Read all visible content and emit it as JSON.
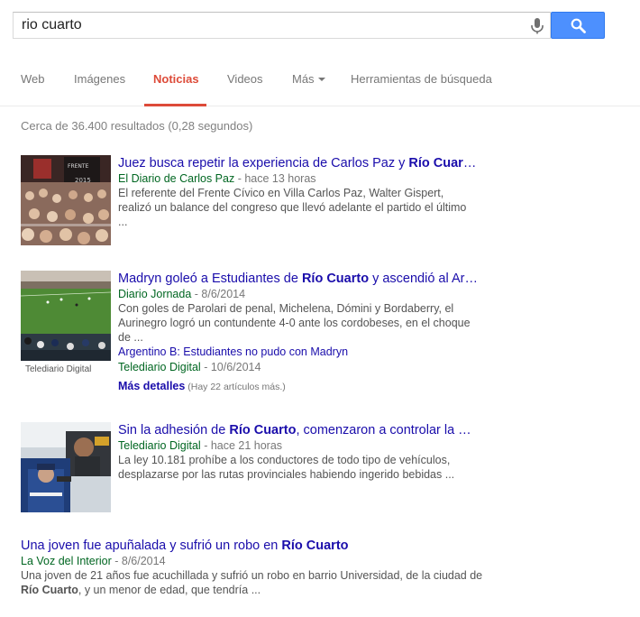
{
  "search": {
    "query": "rio cuarto"
  },
  "tabs": [
    {
      "label": "Web"
    },
    {
      "label": "Imágenes"
    },
    {
      "label": "Noticias"
    },
    {
      "label": "Videos"
    },
    {
      "label": "Más"
    },
    {
      "label": "Herramientas de búsqueda"
    }
  ],
  "stats": "Cerca de 36.400 resultados (0,28 segundos)",
  "results": [
    {
      "title_pre": "Juez busca repetir la experiencia de Carlos Paz y ",
      "title_bold": "Río Cuar",
      "title_post": "…",
      "source": "El Diario de Carlos Paz",
      "date": " - hace 13 horas",
      "snippet": "El referente del Frente Cívico en Villa Carlos Paz, Walter Gispert, realizó un balance del congreso que llevó adelante el partido el último ..."
    },
    {
      "title_pre": "Madryn goleó a Estudiantes de ",
      "title_bold": "Río Cuarto",
      "title_post": " y ascendió al Ar…",
      "source": "Diario Jornada",
      "date": " - 8/6/2014",
      "snippet": "Con goles de Parolari de penal, Michelena, Dómini y Bordaberry, el Aurinegro logró un contundente 4-0 ante los cordobeses, en el choque de ...",
      "sub_title": "Argentino B: Estudiantes no pudo con Madryn",
      "sub_source": "Telediario Digital",
      "sub_date": " - 10/6/2014",
      "more_label": "Más detalles",
      "more_note": " (Hay 22 artículos más.)",
      "caption": "Telediario Digital"
    },
    {
      "title_pre": "Sin la adhesión de ",
      "title_bold": "Río Cuarto",
      "title_post": ", comenzaron a controlar la …",
      "source": "Telediario Digital",
      "date": " - hace 21 horas",
      "snippet": "La ley 10.181 prohíbe a los conductores de todo tipo de vehículos, desplazarse por las rutas provinciales habiendo ingerido bebidas ..."
    },
    {
      "title_pre": "Una joven fue apuñalada y sufrió un robo en ",
      "title_bold": "Río Cuarto",
      "title_post": "",
      "source": "La Voz del Interior",
      "date": " - 8/6/2014",
      "snippet_pre": "Una joven de 21 años fue acuchillada y sufrió un robo en barrio Universidad, de la ciudad de ",
      "snippet_bold": "Río Cuarto",
      "snippet_post": ", y un menor de edad, que tendría ..."
    }
  ],
  "icons": {
    "mic": "microphone-icon",
    "search": "search-icon",
    "more_caret": "caret-down-icon"
  },
  "colors": {
    "link": "#1a0dab",
    "source": "#006621",
    "active_tab": "#dd4b39",
    "search_button": "#4d90fe"
  }
}
